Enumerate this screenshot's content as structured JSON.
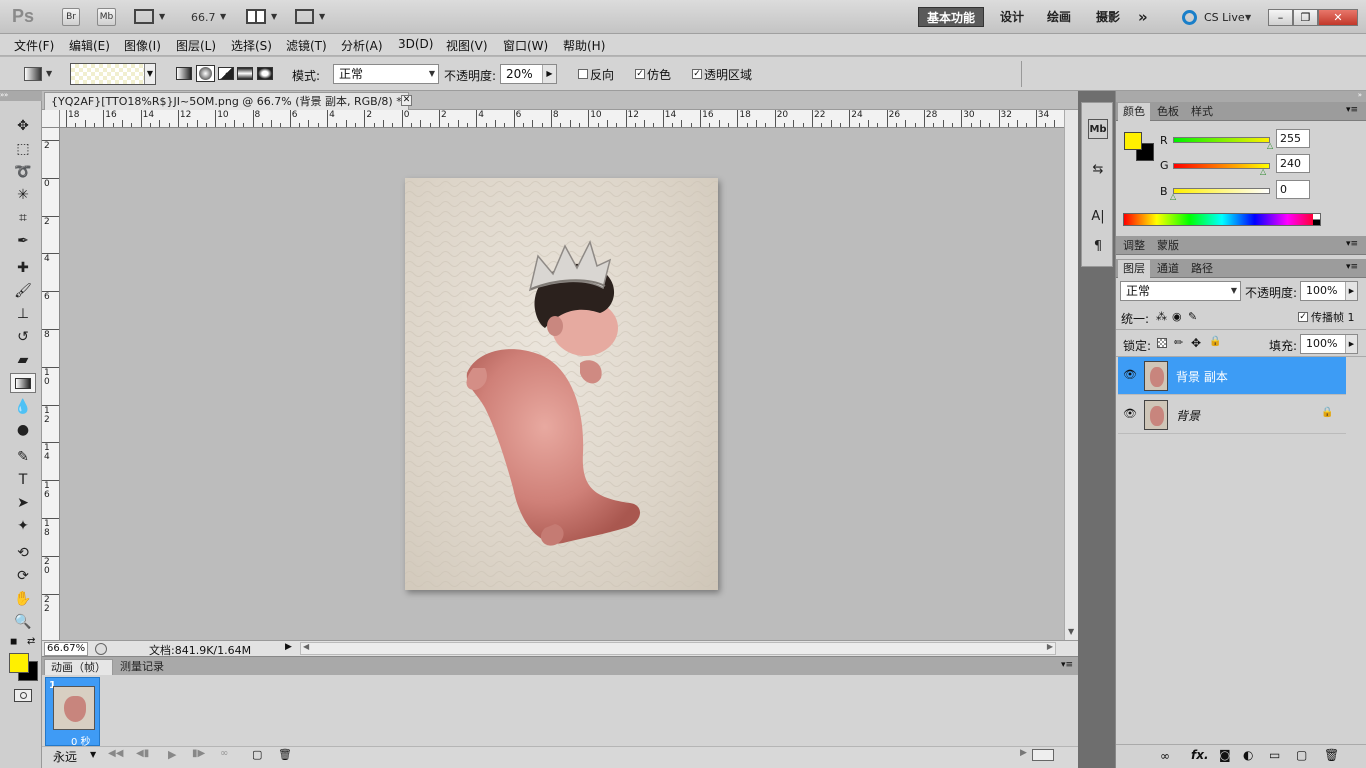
{
  "app": {
    "logo": "Ps",
    "bridge_label": "Br",
    "minibridge_label": "Mb",
    "zoom_value": "66.7",
    "workspaces": [
      "基本功能",
      "设计",
      "绘画",
      "摄影"
    ],
    "more_workspaces": "»",
    "cs_live": "CS Live"
  },
  "menu": [
    "文件(F)",
    "编辑(E)",
    "图像(I)",
    "图层(L)",
    "选择(S)",
    "滤镜(T)",
    "分析(A)",
    "3D(D)",
    "视图(V)",
    "窗口(W)",
    "帮助(H)"
  ],
  "options": {
    "mode_label": "模式:",
    "mode_value": "正常",
    "opacity_label": "不透明度:",
    "opacity_value": "20%",
    "reverse_label": "反向",
    "reverse_checked": false,
    "dither_label": "仿色",
    "dither_checked": true,
    "transparency_label": "透明区域",
    "transparency_checked": true
  },
  "document": {
    "tab_title": "{YQ2AF}[TTO18%R$}JI~5OM.png @ 66.7% (背景 副本, RGB/8) *",
    "ruler_h": [
      "18",
      "16",
      "14",
      "12",
      "10",
      "8",
      "6",
      "4",
      "2",
      "0",
      "2",
      "4",
      "6",
      "8",
      "10",
      "12",
      "14",
      "16",
      "18",
      "20",
      "22",
      "24",
      "26",
      "28",
      "30",
      "32",
      "34"
    ],
    "ruler_v": [
      "2",
      "0",
      "2",
      "4",
      "6",
      "8",
      "10",
      "12",
      "14",
      "16",
      "18",
      "20",
      "22"
    ],
    "zoom": "66.67%",
    "doc_info": "文档:841.9K/1.64M"
  },
  "animation": {
    "tabs": [
      "动画（帧）",
      "测量记录"
    ],
    "frame_number": "1",
    "frame_delay": "0 秒",
    "loop": "永远"
  },
  "color_panel": {
    "tabs": [
      "颜色",
      "色板",
      "样式"
    ],
    "r_label": "R",
    "r_value": "255",
    "g_label": "G",
    "g_value": "240",
    "b_label": "B",
    "b_value": "0",
    "foreground_color": "#fff000",
    "background_color": "#000000"
  },
  "adjust_panel": {
    "tabs": [
      "调整",
      "蒙版"
    ]
  },
  "layers_panel": {
    "tabs": [
      "图层",
      "通道",
      "路径"
    ],
    "blend_mode": "正常",
    "opacity_label": "不透明度:",
    "opacity_value": "100%",
    "unify_label": "统一:",
    "propagate_label": "传播帧 1",
    "lock_label": "锁定:",
    "fill_label": "填充:",
    "fill_value": "100%",
    "layers": [
      {
        "name": "背景 副本",
        "selected": true
      },
      {
        "name": "背景",
        "selected": false,
        "locked": true
      }
    ],
    "footer_icons": [
      "link-icon",
      "fx-icon",
      "mask-icon",
      "adjustment-icon",
      "group-icon",
      "new-layer-icon",
      "trash-icon"
    ]
  }
}
